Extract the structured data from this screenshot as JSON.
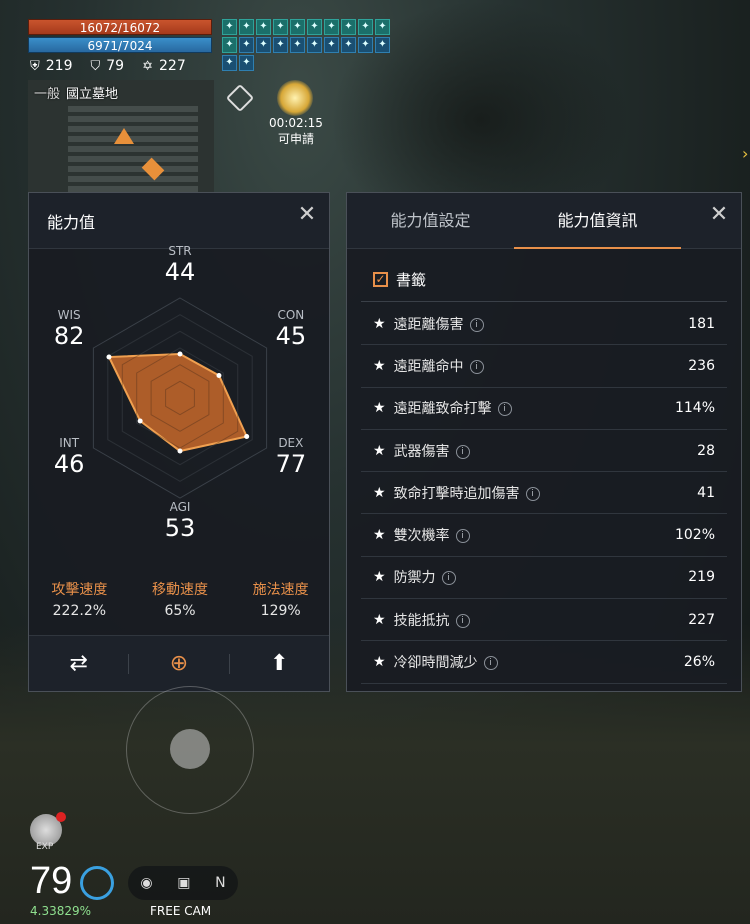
{
  "hud": {
    "hp": "16072/16072",
    "mp": "6971/7024",
    "defense": "219",
    "resist": "79",
    "misc_stat": "227",
    "buffs": [
      "buff",
      "buff",
      "buff",
      "buff",
      "buff",
      "buff",
      "buff",
      "buff",
      "buff",
      "buff",
      "buff",
      "buff",
      "buff",
      "buff",
      "buff",
      "buff",
      "buff",
      "buff",
      "buff",
      "buff",
      "buff",
      "buff"
    ]
  },
  "minimap": {
    "mode": "一般",
    "location": "國立墓地"
  },
  "event": {
    "timer": "00:02:15",
    "status": "可申請"
  },
  "stats_panel": {
    "title": "能力值",
    "axes": [
      {
        "label": "STR",
        "value": "44"
      },
      {
        "label": "CON",
        "value": "45"
      },
      {
        "label": "DEX",
        "value": "77"
      },
      {
        "label": "AGI",
        "value": "53"
      },
      {
        "label": "INT",
        "value": "46"
      },
      {
        "label": "WIS",
        "value": "82"
      }
    ],
    "speeds": [
      {
        "label": "攻擊速度",
        "value": "222.2%"
      },
      {
        "label": "移動速度",
        "value": "65%"
      },
      {
        "label": "施法速度",
        "value": "129%"
      }
    ]
  },
  "chart_data": {
    "type": "radar",
    "categories": [
      "STR",
      "CON",
      "DEX",
      "AGI",
      "INT",
      "WIS"
    ],
    "values": [
      44,
      45,
      77,
      53,
      46,
      82
    ],
    "fill_color": "#c8682a"
  },
  "info_panel": {
    "tabs": [
      "能力值設定",
      "能力值資訊"
    ],
    "active_tab": 1,
    "bookmark_label": "書籤",
    "rows": [
      {
        "name": "遠距離傷害",
        "value": "181"
      },
      {
        "name": "遠距離命中",
        "value": "236"
      },
      {
        "name": "遠距離致命打擊",
        "value": "114%"
      },
      {
        "name": "武器傷害",
        "value": "28"
      },
      {
        "name": "致命打擊時追加傷害",
        "value": "41"
      },
      {
        "name": "雙次機率",
        "value": "102%"
      },
      {
        "name": "防禦力",
        "value": "219"
      },
      {
        "name": "技能抵抗",
        "value": "227"
      },
      {
        "name": "冷卻時間減少",
        "value": "26%"
      }
    ]
  },
  "bottom": {
    "exp_label": "EXP",
    "level": "79",
    "exp_percent": "4.33829%",
    "cam_label": "FREE CAM",
    "compass": "N"
  },
  "colors": {
    "accent": "#e8904a",
    "hp": "#c9542d",
    "mp": "#3a8fc9"
  }
}
